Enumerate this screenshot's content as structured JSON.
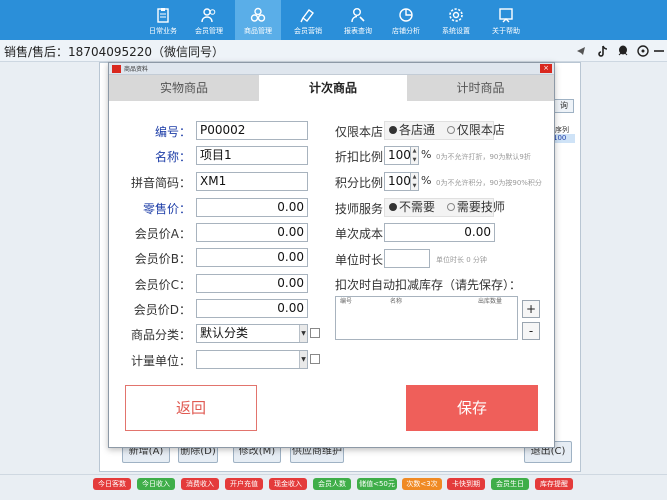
{
  "nav": {
    "items": [
      {
        "label": "日常业务",
        "icon": "clipboard-icon"
      },
      {
        "label": "会员管理",
        "icon": "members-icon"
      },
      {
        "label": "商品管理",
        "icon": "products-icon"
      },
      {
        "label": "会员营销",
        "icon": "marketing-icon"
      },
      {
        "label": "报表查询",
        "icon": "report-icon"
      },
      {
        "label": "店铺分析",
        "icon": "pie-chart-icon"
      },
      {
        "label": "系统设置",
        "icon": "gear-icon"
      },
      {
        "label": "关于帮助",
        "icon": "help-icon"
      }
    ],
    "active_index": 2,
    "bg_color": "#2b8fd9"
  },
  "user_bar": {
    "text": "销售/售后：18704095220（微信同号）"
  },
  "dialog": {
    "title": "商品资料",
    "tabs": [
      "实物商品",
      "计次商品",
      "计时商品"
    ],
    "active_tab": 1
  },
  "form": {
    "code_label": "编号：",
    "code_value": "P00002",
    "name_label": "名称：",
    "name_value": "项目1",
    "pinyin_label": "拼音简码：",
    "pinyin_value": "XM1",
    "retail_label": "零售价：",
    "retail_value": "0.00",
    "member_a_label": "会员价A：",
    "member_a_value": "0.00",
    "member_b_label": "会员价B：",
    "member_b_value": "0.00",
    "member_c_label": "会员价C：",
    "member_c_value": "0.00",
    "member_d_label": "会员价D：",
    "member_d_value": "0.00",
    "category_label": "商品分类：",
    "category_value": "默认分类",
    "unit_label": "计量单位：",
    "unit_value": ""
  },
  "right_form": {
    "store_label": "仅限本店：",
    "store_options": [
      "各店通",
      "仅限本店"
    ],
    "store_selected": 0,
    "discount_label": "折扣比例：",
    "discount_value": "100",
    "discount_unit": "%",
    "discount_hint": "0为不允许打折，90为默认9折",
    "points_label": "积分比例：",
    "points_value": "100",
    "points_unit": "%",
    "points_hint": "0为不允许积分，90为按90%积分",
    "tech_label": "技师服务：",
    "tech_options": [
      "不需要",
      "需要技师"
    ],
    "tech_selected": 0,
    "cost_label": "单次成本：",
    "cost_value": "0.00",
    "duration_label": "单位时长：",
    "duration_value": "",
    "duration_hint": "单位时长 0 分钟",
    "deduct_label": "扣次时自动扣减库存（请先保存）：",
    "grid_headers": [
      "编号",
      "名称",
      "出库数量"
    ],
    "add_label": "+",
    "remove_label": "-"
  },
  "buttons": {
    "back": "返回",
    "save": "保存"
  },
  "background": {
    "buttons": [
      "新增(A)",
      "删除(D)",
      "修改(M)",
      "供应商维护",
      "退出(C)"
    ],
    "right_col": [
      "询",
      "序列",
      "100"
    ]
  },
  "status_badges": [
    {
      "label": "今日客数",
      "color": "#e43b3b"
    },
    {
      "label": "今日收入",
      "color": "#3fae49"
    },
    {
      "label": "消费收入",
      "color": "#e43b3b"
    },
    {
      "label": "开户充值",
      "color": "#e43b3b"
    },
    {
      "label": "现金收入",
      "color": "#e43b3b"
    },
    {
      "label": "会员人数",
      "color": "#3fae49"
    },
    {
      "label": "储值<50元",
      "color": "#3fae49"
    },
    {
      "label": "次数<3次",
      "color": "#f08a24"
    },
    {
      "label": "卡快到期",
      "color": "#e43b3b"
    },
    {
      "label": "会员生日",
      "color": "#3fae49"
    },
    {
      "label": "库存提醒",
      "color": "#e43b3b"
    }
  ]
}
